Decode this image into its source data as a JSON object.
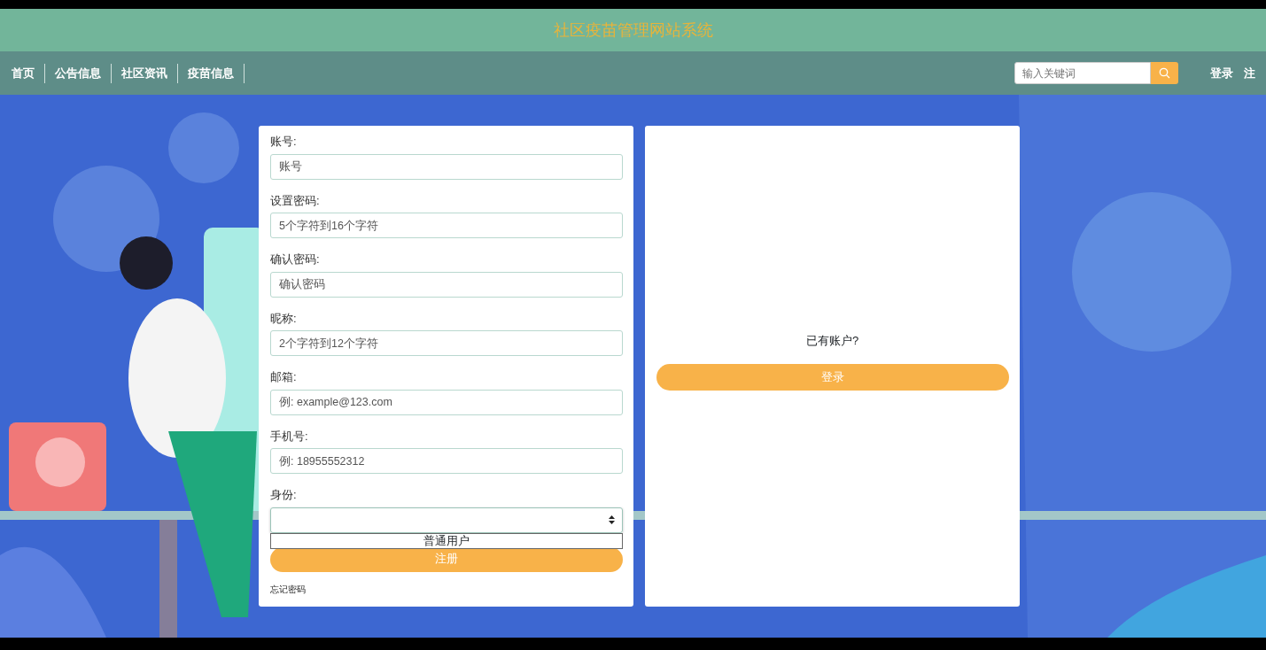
{
  "header": {
    "title": "社区疫苗管理网站系统"
  },
  "nav": {
    "items": [
      {
        "label": "首页"
      },
      {
        "label": "公告信息"
      },
      {
        "label": "社区资讯"
      },
      {
        "label": "疫苗信息"
      }
    ],
    "search": {
      "placeholder": "输入关键词"
    },
    "links": [
      {
        "label": "登录"
      },
      {
        "label": "注"
      }
    ]
  },
  "register_form": {
    "fields": [
      {
        "kind": "text",
        "label": "账号:",
        "placeholder": "账号"
      },
      {
        "kind": "text",
        "label": "设置密码:",
        "placeholder": "5个字符到16个字符"
      },
      {
        "kind": "text",
        "label": "确认密码:",
        "placeholder": "确认密码"
      },
      {
        "kind": "text",
        "label": "昵称:",
        "placeholder": "2个字符到12个字符"
      },
      {
        "kind": "text",
        "label": "邮箱:",
        "placeholder": "例: example@123.com"
      },
      {
        "kind": "text",
        "label": "手机号:",
        "placeholder": "例: 18955552312"
      },
      {
        "kind": "select",
        "label": "身份:",
        "expanded": true,
        "options": [
          "普通用户"
        ]
      }
    ],
    "submit": "注册",
    "forgot": "忘记密码"
  },
  "login_panel": {
    "prompt": "已有账户?",
    "button": "登录"
  }
}
